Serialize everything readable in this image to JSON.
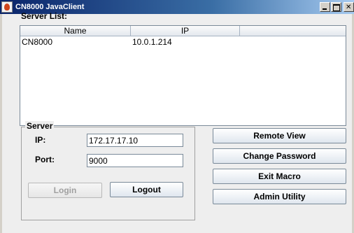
{
  "window": {
    "title": "CN8000 JavaClient",
    "icon": "java-cup-icon"
  },
  "server_list": {
    "label": "Server List:",
    "columns": [
      "Name",
      "IP",
      ""
    ],
    "rows": [
      {
        "name": "CN8000",
        "ip": "10.0.1.214"
      }
    ]
  },
  "server": {
    "legend": "Server",
    "ip_label": "IP:",
    "ip_value": "172.17.17.10",
    "port_label": "Port:",
    "port_value": "9000",
    "login_label": "Login",
    "logout_label": "Logout"
  },
  "actions": {
    "remote_view": "Remote View",
    "change_password": "Change Password",
    "exit_macro": "Exit Macro",
    "admin_utility": "Admin Utility"
  }
}
